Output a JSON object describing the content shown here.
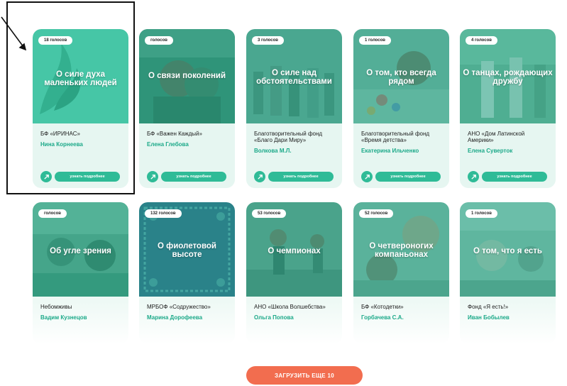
{
  "cards": [
    {
      "votes": "18 голосов",
      "caption": "О силе духа маленьких людей",
      "org": "БФ «ИРИНАС»",
      "person": "Нина Корнеева",
      "more_label": "узнать подробнее"
    },
    {
      "votes": "голосов",
      "caption": "О связи поколений",
      "org": "БФ «Важен Каждый»",
      "person": "Елена Глебова",
      "more_label": "узнать подробнее"
    },
    {
      "votes": "3 голосов",
      "caption": "О силе над обстоятельствами",
      "org": "Благотворительный фонд «Благо Дари Миру»",
      "person": "Волкова М.Л.",
      "more_label": "узнать подробнее"
    },
    {
      "votes": "1 голосов",
      "caption": "О том, кто всегда рядом",
      "org": "Благотворительный фонд «Время детства»",
      "person": "Екатерина Ильченко",
      "more_label": "узнать подробнее"
    },
    {
      "votes": "4 голосов",
      "caption": "О танцах, рождающих дружбу",
      "org": "АНО «Дом Латинской Америки»",
      "person": "Елена Суверток",
      "more_label": "узнать подробнее"
    },
    {
      "votes": "голосов",
      "caption": "Об угле зрения",
      "org": "Небомживы",
      "person": "Вадим Кузнецов"
    },
    {
      "votes": "132 голосов",
      "caption": "О фиолетовой высоте",
      "org": "МРБОФ «Содружество»",
      "person": "Марина Дорофеева"
    },
    {
      "votes": "53 голосов",
      "caption": "О чемпионах",
      "org": "АНО «Школа Волшебства»",
      "person": "Ольга Попова"
    },
    {
      "votes": "52 голосов",
      "caption": "О четвероногих компаньонах",
      "org": "БФ «Котодетки»",
      "person": "Горбачева С.А."
    },
    {
      "votes": "1 голосов",
      "caption": "О том, что я есть",
      "org": "Фонд «Я есть!»",
      "person": "Иван Бобылев"
    }
  ],
  "load_more_label": "ЗАГРУЗИТЬ ЕЩЕ 10",
  "colors": {
    "accent": "#2fbb97",
    "person_text": "#1ca989",
    "load_more": "#f26d4f",
    "card_bg": "#e6f6f1"
  },
  "icons": {
    "share": "share-icon",
    "annotation": "arrow-annotation"
  }
}
